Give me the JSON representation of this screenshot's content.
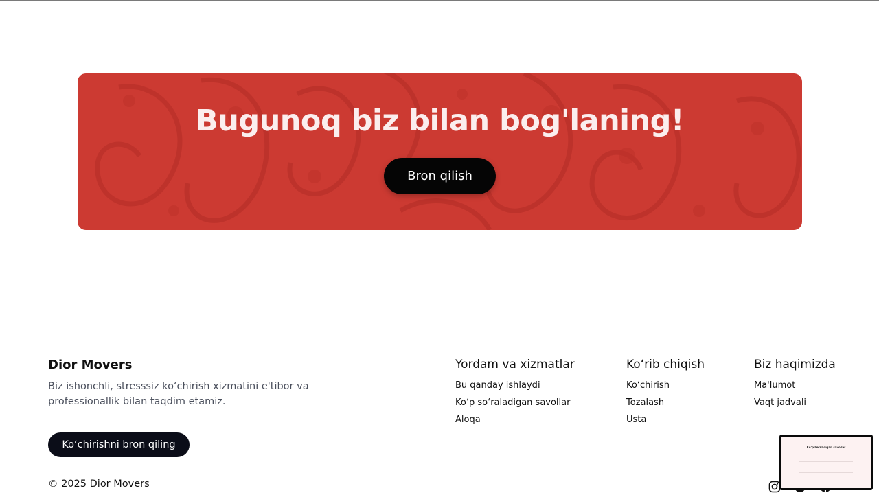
{
  "cta": {
    "title": "Bugunoq biz bilan bog'laning!",
    "button_label": "Bron qilish"
  },
  "footer": {
    "brand": {
      "title": "Dior Movers",
      "description": "Biz ishonchli, stresssiz ko‘chirish xizmatini e'tibor va professionallik bilan taqdim etamiz.",
      "button_label": "Ko‘chirishni bron qiling"
    },
    "columns": [
      {
        "title": "Yordam va xizmatlar",
        "links": [
          "Bu qanday ishlaydi",
          "Ko‘p so‘raladigan savollar",
          "Aloqa"
        ]
      },
      {
        "title": "Ko‘rib chiqish",
        "links": [
          "Ko‘chirish",
          "Tozalash",
          "Usta"
        ]
      },
      {
        "title": "Biz haqimizda",
        "links": [
          "Ma'lumot",
          "Vaqt jadvali"
        ]
      }
    ],
    "copyright": "© 2025 Dior Movers",
    "social": [
      "instagram-icon",
      "telegram-icon",
      "facebook-icon"
    ]
  },
  "preview": {
    "heading": "Ko‘p beriladigan savollar"
  },
  "colors": {
    "banner": "#cc3a32",
    "dark": "#0b0d18"
  }
}
